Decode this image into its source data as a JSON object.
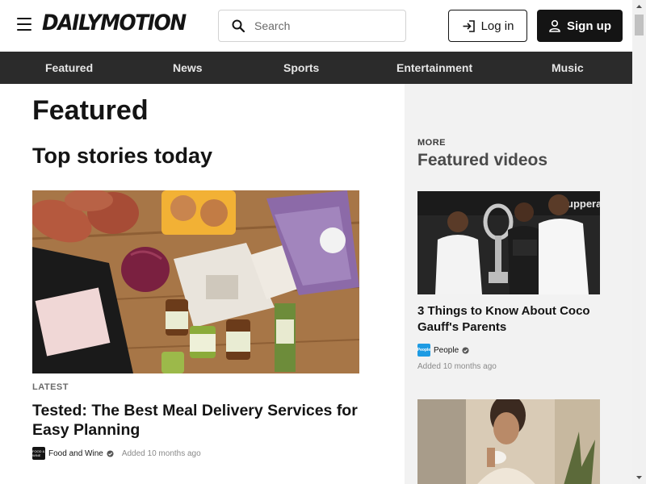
{
  "header": {
    "logo": "DAILYMOTION",
    "search_placeholder": "Search",
    "login_label": "Log in",
    "signup_label": "Sign up"
  },
  "nav": {
    "items": [
      {
        "label": "Featured"
      },
      {
        "label": "News"
      },
      {
        "label": "Sports"
      },
      {
        "label": "Entertainment"
      },
      {
        "label": "Music"
      }
    ]
  },
  "main": {
    "page_title": "Featured",
    "section_title": "Top stories today",
    "story": {
      "tag": "LATEST",
      "title": "Tested: The Best Meal Delivery Services for Easy Planning",
      "source": "Food and Wine",
      "source_logo_text": "FOOD & WINE",
      "added": "Added 10 months ago"
    }
  },
  "aside": {
    "kicker": "MORE",
    "title": "Featured videos",
    "videos": [
      {
        "title": "3 Things to Know About Coco Gauff's Parents",
        "source": "People",
        "source_logo_text": "People",
        "added": "Added 10 months ago",
        "thumb_text": "uppera"
      }
    ]
  },
  "colors": {
    "nav_bg": "#2b2b2b",
    "aside_bg": "#f2f2f2",
    "primary_dark": "#141414",
    "people_blue": "#1e9be3"
  }
}
